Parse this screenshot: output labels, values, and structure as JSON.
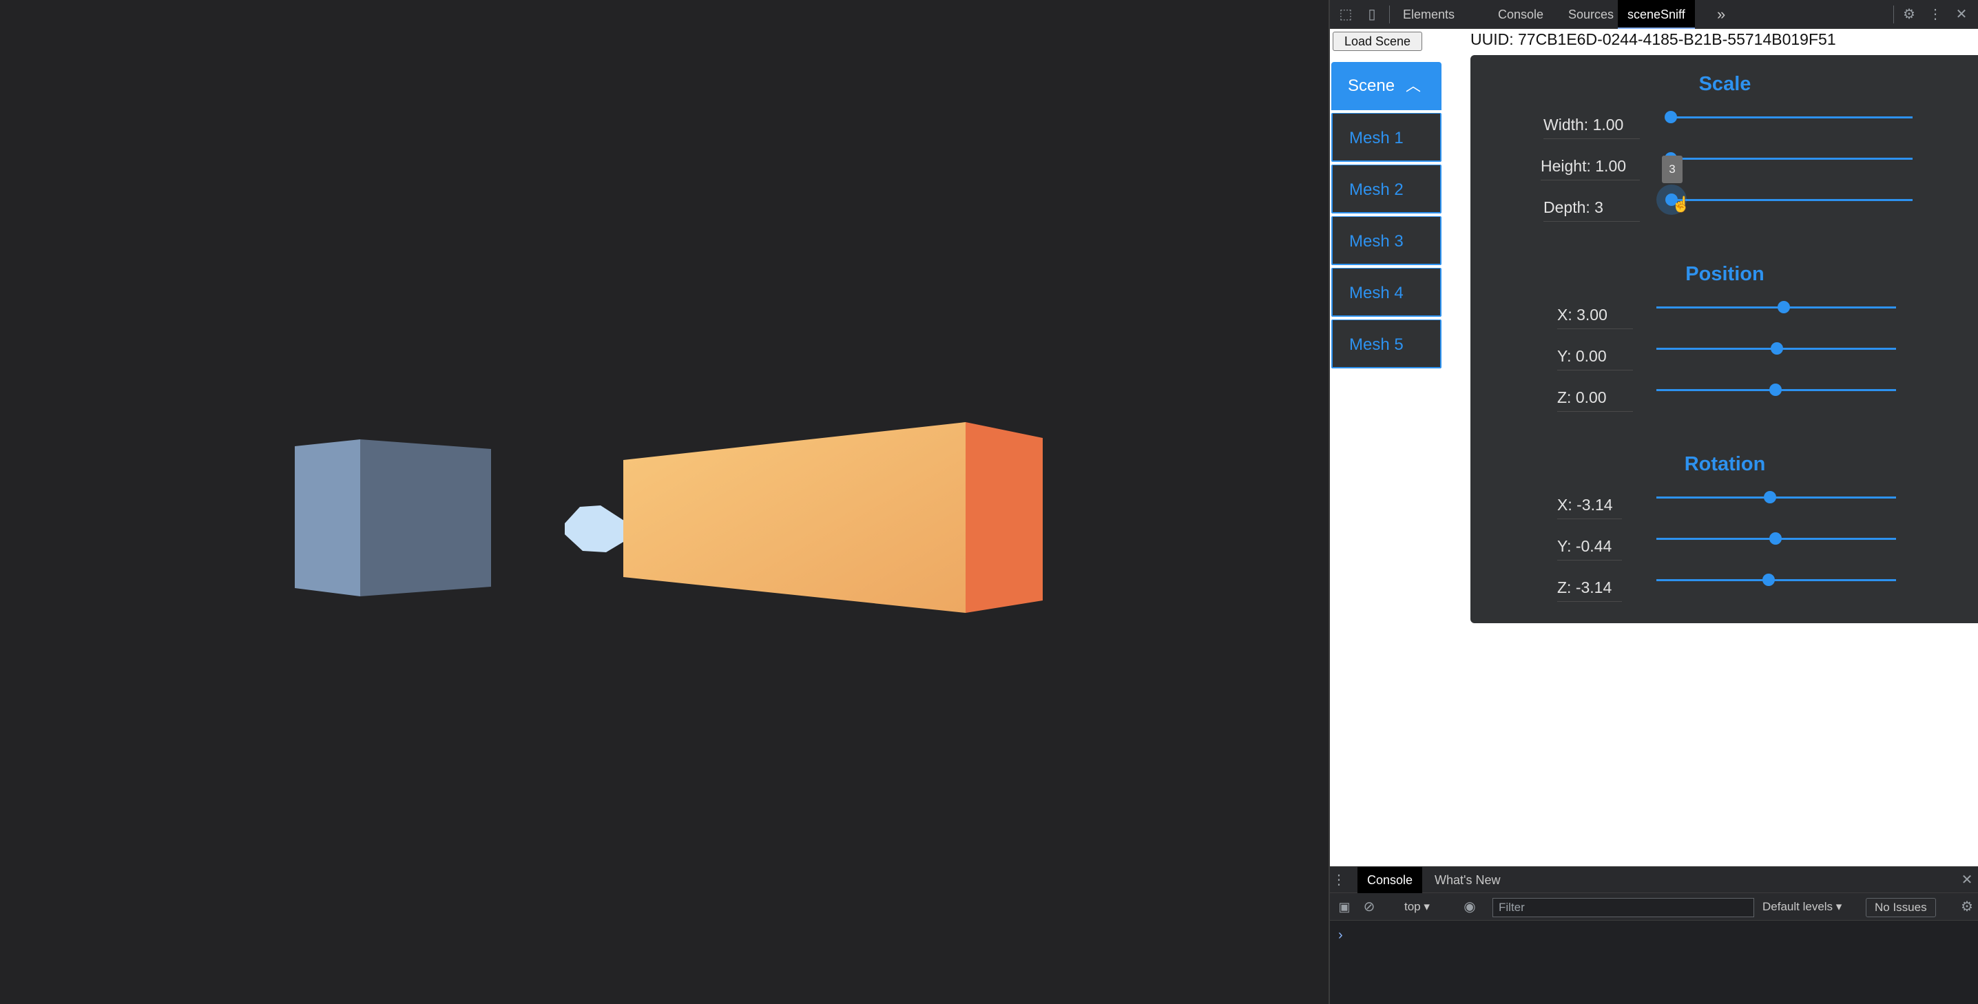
{
  "devtools": {
    "tabs": [
      "Elements",
      "Console",
      "Sources",
      "sceneSniff"
    ],
    "active_tab": "sceneSniff",
    "more_tabs": "»"
  },
  "panel": {
    "load_button": "Load Scene",
    "uuid": "UUID: 77CB1E6D-0244-4185-B21B-55714B019F51",
    "tree": {
      "scene_label": "Scene",
      "meshes": [
        "Mesh 1",
        "Mesh 2",
        "Mesh 3",
        "Mesh 4",
        "Mesh 5"
      ]
    },
    "scale": {
      "title": "Scale",
      "width": "Width: 1.00",
      "height": "Height: 1.00",
      "depth": "Depth: 3",
      "tooltip": "3"
    },
    "position": {
      "title": "Position",
      "x": "X: 3.00",
      "y": "Y: 0.00",
      "z": "Z: 0.00"
    },
    "rotation": {
      "title": "Rotation",
      "x": "X: -3.14",
      "y": "Y: -0.44",
      "z": "Z: -3.14"
    }
  },
  "drawer": {
    "tabs": [
      "Console",
      "What's New"
    ],
    "context": "top ▾",
    "filter_placeholder": "Filter",
    "levels": "Default levels ▾",
    "issues": "No Issues",
    "prompt": "›"
  },
  "colors": {
    "accent": "#2d92f0",
    "cube_front": "#5a6a80",
    "cube_left": "#8099b8",
    "box_front": "#f5b86c",
    "box_side": "#ea7244",
    "sphere": "#c9e2f8"
  }
}
